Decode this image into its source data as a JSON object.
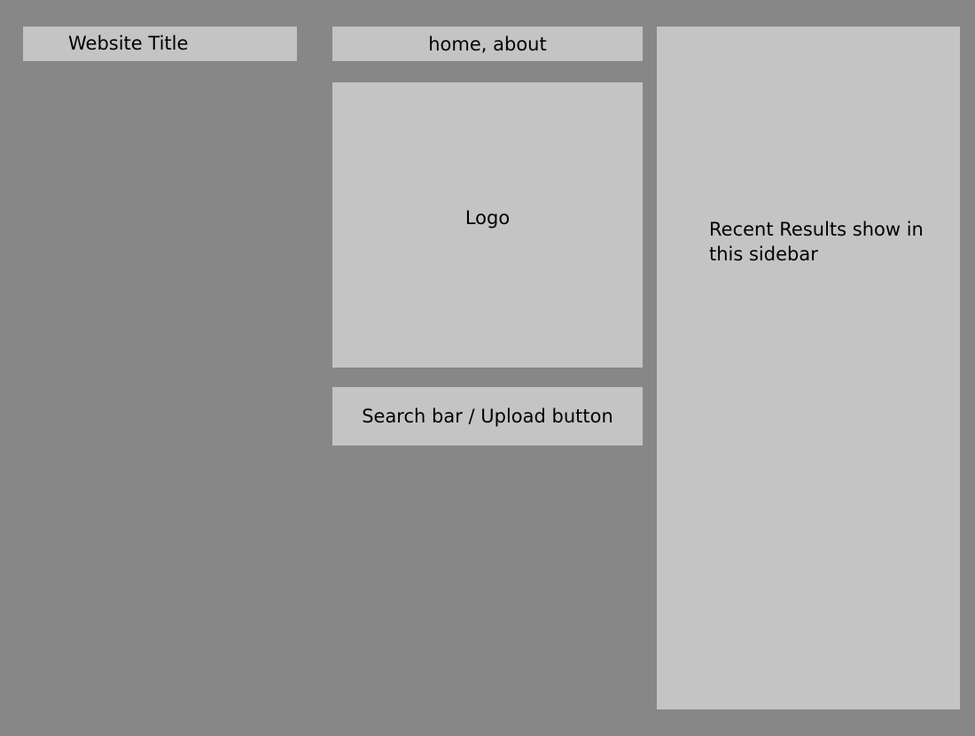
{
  "header": {
    "website_title": "Website Title",
    "nav_links": "home, about"
  },
  "main": {
    "logo_label": "Logo",
    "search_upload_label": "Search bar / Upload button"
  },
  "sidebar": {
    "text": "Recent Results show in this sidebar"
  },
  "colors": {
    "background": "#878787",
    "box": "#c4c4c4",
    "text": "#000000"
  }
}
